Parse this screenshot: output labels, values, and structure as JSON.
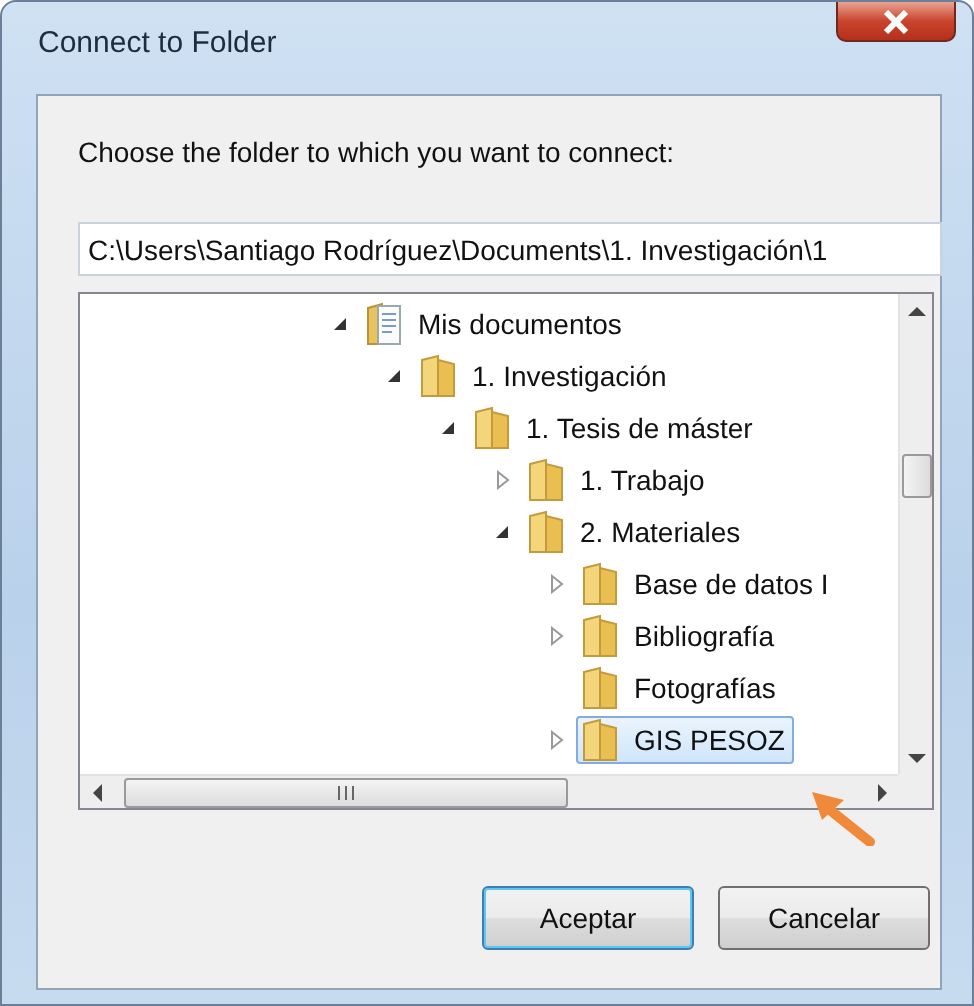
{
  "window": {
    "title": "Connect to Folder"
  },
  "prompt": "Choose the folder to which you want to connect:",
  "path_field": {
    "value": "C:\\Users\\Santiago Rodríguez\\Documents\\1. Investigación\\1"
  },
  "tree": [
    {
      "label": "Mis documentos",
      "kind": "documents",
      "expanded": true,
      "selected": false,
      "children": [
        {
          "label": "1. Investigación",
          "kind": "folder",
          "expanded": true,
          "selected": false,
          "children": [
            {
              "label": "1. Tesis de máster",
              "kind": "folder",
              "expanded": true,
              "selected": false,
              "children": [
                {
                  "label": "1. Trabajo",
                  "kind": "folder",
                  "expanded": false,
                  "selected": false
                },
                {
                  "label": "2. Materiales",
                  "kind": "folder",
                  "expanded": true,
                  "selected": false,
                  "children": [
                    {
                      "label": "Base de datos I",
                      "kind": "folder",
                      "expanded": false,
                      "selected": false
                    },
                    {
                      "label": "Bibliografía",
                      "kind": "folder",
                      "expanded": false,
                      "selected": false
                    },
                    {
                      "label": "Fotografías",
                      "kind": "folder",
                      "selected": false
                    },
                    {
                      "label": "GIS PESOZ",
                      "kind": "folder",
                      "expanded": false,
                      "selected": true
                    }
                  ]
                }
              ]
            }
          ]
        }
      ]
    }
  ],
  "buttons": [
    {
      "label": "Aceptar",
      "default": true
    },
    {
      "label": "Cancelar",
      "default": false
    }
  ]
}
